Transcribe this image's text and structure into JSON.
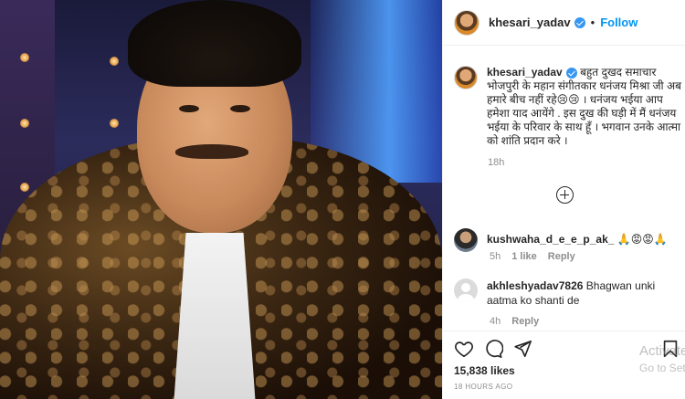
{
  "post": {
    "author": "khesari_yadav",
    "follow_label": "Follow",
    "dot": "•",
    "caption": "बहुत दुखद समाचार भोजपुरी के महान संगीतकार धनंजय मिश्रा जी अब हमारे बीच नहीं रहे😢😢 । धनंजय भईया आप हमेशा याद आयेंगे . इस दुख की घड़ी में मैं धनंजय भईया के परिवार के साथ हूँ । भगवान उनके आत्मा को शांति प्रदान करे ।",
    "caption_time": "18h",
    "likes": "15,838 likes",
    "posted": "18 HOURS AGO"
  },
  "comments": [
    {
      "username": "kushwaha_d_e_e_p_ak_",
      "text": "🙏😡😡🙏",
      "time": "5h",
      "likes": "1 like",
      "reply": "Reply"
    },
    {
      "username": "akhleshyadav7826",
      "text": "Bhagwan unki aatma ko shanti de",
      "time": "4h",
      "reply": "Reply"
    }
  ],
  "watermark": {
    "line1": "Activate",
    "line2": "Go to Set"
  },
  "icons": {
    "verified": "verified-badge-icon",
    "like": "heart-icon",
    "comment": "comment-icon",
    "share": "paper-plane-icon",
    "save": "bookmark-icon",
    "load_more": "plus-circle-icon"
  },
  "colors": {
    "accent": "#0095f6",
    "verified": "#3897f0",
    "muted": "#8e8e8e",
    "text": "#262626"
  }
}
